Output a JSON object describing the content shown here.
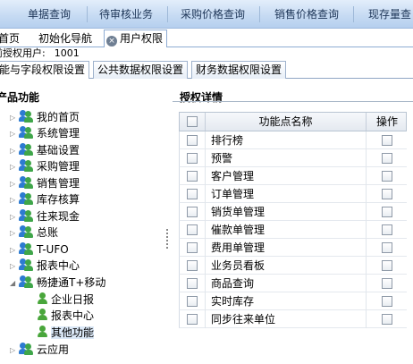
{
  "topnav": {
    "items": [
      "单据查询",
      "待审核业务",
      "采购价格查询",
      "销售价格查询",
      "现存量查"
    ]
  },
  "page_tabs": [
    {
      "label": "首页"
    },
    {
      "label": "初始化导航"
    },
    {
      "label": "用户权限",
      "active": true
    }
  ],
  "close_symbol": "×",
  "user": {
    "label": "前授权用户:",
    "value": "1001"
  },
  "sub_tabs": [
    "功能与字段权限设置",
    "公共数据权限设置",
    "财务数据权限设置"
  ],
  "left_panel": {
    "title": "产品功能",
    "tree": [
      {
        "label": "我的首页",
        "arrow": "▷",
        "icon": "group-icon"
      },
      {
        "label": "系统管理",
        "arrow": "▷",
        "icon": "group-icon"
      },
      {
        "label": "基础设置",
        "arrow": "▷",
        "icon": "group-icon"
      },
      {
        "label": "采购管理",
        "arrow": "▷",
        "icon": "group-icon"
      },
      {
        "label": "销售管理",
        "arrow": "▷",
        "icon": "group-icon"
      },
      {
        "label": "库存核算",
        "arrow": "▷",
        "icon": "group-icon"
      },
      {
        "label": "往来现金",
        "arrow": "▷",
        "icon": "group-icon"
      },
      {
        "label": "总账",
        "arrow": "▷",
        "icon": "group-icon"
      },
      {
        "label": "T-UFO",
        "arrow": "▷",
        "icon": "group-icon"
      },
      {
        "label": "报表中心",
        "arrow": "▷",
        "icon": "group-icon"
      },
      {
        "label": "畅捷通T+移动",
        "arrow": "◢",
        "icon": "group-icon",
        "children": [
          {
            "label": "企业日报",
            "icon": "user-icon"
          },
          {
            "label": "报表中心",
            "icon": "user-icon"
          },
          {
            "label": "其他功能",
            "icon": "user-icon",
            "selected": true
          }
        ]
      },
      {
        "label": "云应用",
        "arrow": "▷",
        "icon": "group-icon"
      }
    ]
  },
  "right_panel": {
    "title": "授权详情",
    "columns": {
      "name": "功能点名称",
      "op": "操作"
    },
    "rows": [
      "排行榜",
      "预警",
      "客户管理",
      "订单管理",
      "销货单管理",
      "催款单管理",
      "费用单管理",
      "业务员看板",
      "商品查询",
      "实时库存",
      "同步往来单位"
    ]
  },
  "colors": {
    "nav_bg": "#c7dbf3",
    "selected_bg": "#dbe8f7",
    "person_green": "#49a63b",
    "person_blue": "#2d7bd1"
  }
}
